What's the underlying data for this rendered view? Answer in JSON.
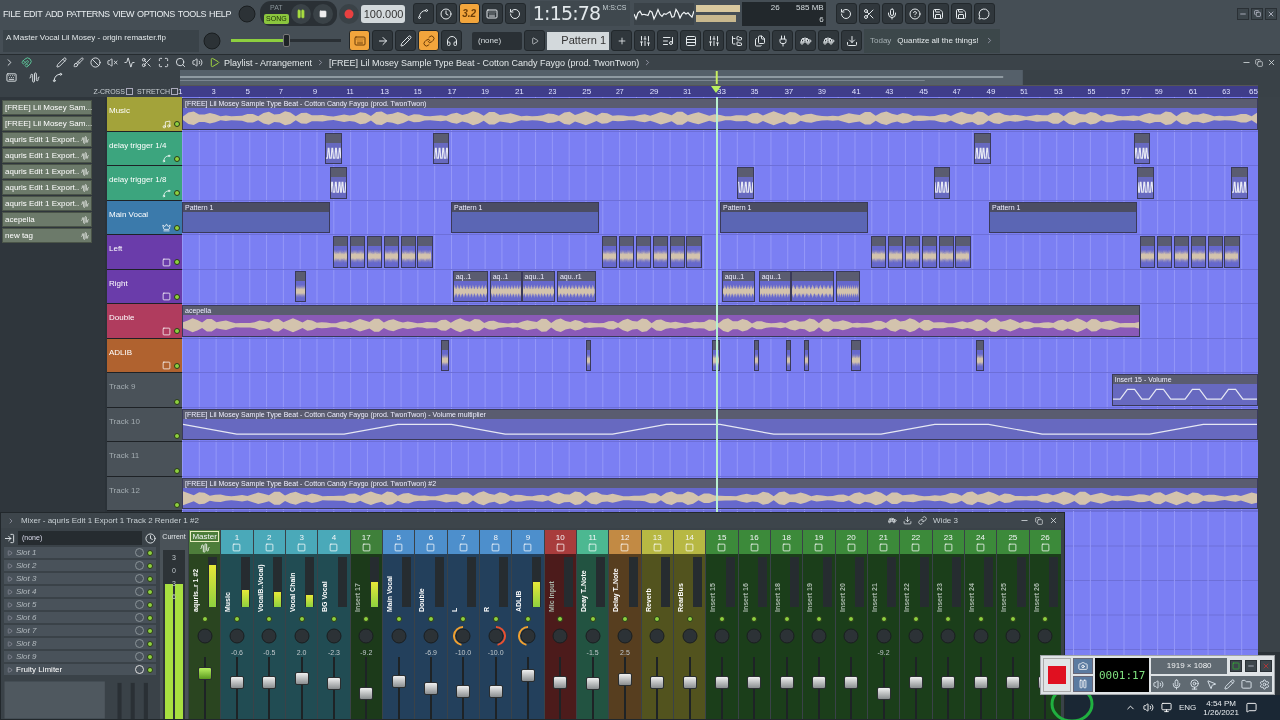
{
  "menu": [
    "FILE",
    "EDIT",
    "ADD",
    "PATTERNS",
    "VIEW",
    "OPTIONS",
    "TOOLS",
    "HELP"
  ],
  "transport": {
    "modes": [
      {
        "label": "PAT",
        "selected": false
      },
      {
        "label": "SONG",
        "selected": true
      }
    ],
    "tempo": "100.000"
  },
  "tools_top": [
    {
      "on": false
    },
    {
      "on": false
    },
    {
      "on": true,
      "label": "3.2"
    },
    {
      "on": false
    },
    {
      "on": false
    }
  ],
  "time": "1:15:78",
  "time_unit": "M:S:CS",
  "monitor": {
    "cpu": "26",
    "memory": "585 MB",
    "polyphony": "6"
  },
  "file_name": "A Master Vocal Lil Mosey - origin remaster.flp",
  "master_volume": {
    "level": 0.5
  },
  "tools_bottom": [
    {
      "on": true
    },
    {
      "on": false
    },
    {
      "on": false
    },
    {
      "on": true
    },
    {
      "on": false
    }
  ],
  "pattern_route": "(none)",
  "pattern": "Pattern 1",
  "hint": {
    "label": "Today",
    "text": "Quantize all the things!"
  },
  "playlist": {
    "title": "Playlist - Arrangement",
    "breadcrumb": "[FREE] Lil Mosey Sample Type Beat  - Cotton Candy Faygo (prod. TwonTwon)",
    "z_cross": {
      "label": "Z-CROSS",
      "checked": false
    },
    "stretch": {
      "label": "STRETCH",
      "checked": false
    },
    "ruler": [
      "1",
      "3",
      "5",
      "7",
      "9",
      "11",
      "13",
      "15",
      "17",
      "19",
      "21",
      "23",
      "25",
      "27",
      "29",
      "31",
      "33",
      "35",
      "37",
      "39",
      "41",
      "43",
      "45",
      "47",
      "49",
      "51",
      "53",
      "55",
      "57",
      "59",
      "61",
      "63",
      "65"
    ],
    "song_position": {
      "level": 0.497
    },
    "tags": [
      "[FREE] Lil Mosey Sam...",
      "[FREE] Lil Mosey Sam...",
      "aquris Edit 1 Export..",
      "aquris Edit 1 Export..",
      "aquris Edit 1 Export..",
      "aquris Edit 1 Export..",
      "aquris Edit 1 Export..",
      "acepella",
      "new tag"
    ],
    "tracks": [
      {
        "name": "Music",
        "color": "#a3a33a",
        "dimmed": false,
        "clips": [
          {
            "kind": "audio",
            "label": "[FREE] Lil Mosey Sample Type Beat  - Cotton Candy Faygo (prod. TwonTwon)"
          }
        ]
      },
      {
        "name": "delay trigger 1/4",
        "color": "#3ca57e",
        "dimmed": false,
        "clips": [
          {
            "kind": "automation"
          },
          {
            "kind": "automation"
          },
          {
            "kind": "automation"
          },
          {
            "kind": "automation"
          }
        ]
      },
      {
        "name": "delay trigger 1/8",
        "color": "#3ca57e",
        "dimmed": false,
        "clips": [
          {
            "kind": "automation"
          },
          {
            "kind": "automation"
          },
          {
            "kind": "automation"
          },
          {
            "kind": "automation"
          },
          {
            "kind": "automation"
          }
        ]
      },
      {
        "name": "Main Vocal",
        "color": "#3b7aab",
        "dimmed": false,
        "clips": [
          {
            "kind": "pattern",
            "label": "Pattern 1"
          },
          {
            "kind": "pattern",
            "label": "Pattern 1"
          },
          {
            "kind": "pattern",
            "label": "Pattern 1"
          },
          {
            "kind": "pattern",
            "label": "Pattern 1"
          }
        ]
      },
      {
        "name": "Left",
        "color": "#6a3caa",
        "dimmed": false,
        "clips": [
          {
            "kind": "audio"
          },
          {
            "kind": "audio"
          },
          {
            "kind": "audio"
          },
          {
            "kind": "audio"
          },
          {
            "kind": "audio"
          },
          {
            "kind": "audio"
          },
          {
            "kind": "audio"
          },
          {
            "kind": "audio"
          },
          {
            "kind": "audio"
          },
          {
            "kind": "audio"
          },
          {
            "kind": "audio"
          },
          {
            "kind": "audio"
          },
          {
            "kind": "audio"
          },
          {
            "kind": "audio"
          },
          {
            "kind": "audio"
          },
          {
            "kind": "audio"
          },
          {
            "kind": "audio"
          },
          {
            "kind": "audio"
          },
          {
            "kind": "audio"
          },
          {
            "kind": "audio"
          },
          {
            "kind": "audio"
          },
          {
            "kind": "audio"
          },
          {
            "kind": "audio"
          },
          {
            "kind": "audio"
          }
        ]
      },
      {
        "name": "Right",
        "color": "#6a3caa",
        "dimmed": false,
        "clips": [
          {
            "kind": "audio"
          },
          {
            "kind": "audio",
            "label": "aq..1"
          },
          {
            "kind": "audio",
            "label": "aq..1"
          },
          {
            "kind": "audio",
            "label": "aqu..1"
          },
          {
            "kind": "audio",
            "label": "aqu..r1"
          },
          {
            "kind": "audio",
            "label": "aqu..1"
          },
          {
            "kind": "audio",
            "label": "aqu..1"
          },
          {
            "kind": "audio"
          },
          {
            "kind": "audio"
          }
        ]
      },
      {
        "name": "Double",
        "color": "#b03c5e",
        "dimmed": false,
        "clips": [
          {
            "kind": "audio",
            "label": "acepella",
            "color": "#8a5ab8"
          }
        ]
      },
      {
        "name": "ADLIB",
        "color": "#b0622f",
        "dimmed": false,
        "clips": [
          {
            "kind": "audio"
          },
          {
            "kind": "audio"
          },
          {
            "kind": "audio"
          },
          {
            "kind": "audio"
          },
          {
            "kind": "audio"
          },
          {
            "kind": "audio"
          },
          {
            "kind": "audio"
          },
          {
            "kind": "audio"
          }
        ]
      },
      {
        "name": "Track 9",
        "color": "#4a5259",
        "dimmed": true,
        "clips": [
          {
            "kind": "automation",
            "label": "Insert 15 - Volume"
          }
        ]
      },
      {
        "name": "Track 10",
        "color": "#4a5259",
        "dimmed": true,
        "clips": [
          {
            "kind": "automation",
            "label": "[FREE] Lil Mosey Sample Type Beat  - Cotton Candy Faygo (prod. TwonTwon) - Volume multiplier"
          }
        ]
      },
      {
        "name": "Track 11",
        "color": "#4a5259",
        "dimmed": true
      },
      {
        "name": "Track 12",
        "color": "#4a5259",
        "dimmed": true,
        "clips": [
          {
            "kind": "audio",
            "label": "[FREE] Lil Mosey Sample Type Beat  - Cotton Candy Faygo (prod. TwonTwon) #2"
          }
        ]
      }
    ]
  },
  "mixer": {
    "title": "Mixer - aquris Edit 1 Export 1 Track 2 Render 1 #2",
    "preset": "Wide 3",
    "route": "(none)",
    "slots": [
      {
        "name": "Slot 1",
        "filled": false
      },
      {
        "name": "Slot 2",
        "filled": false
      },
      {
        "name": "Slot 3",
        "filled": false
      },
      {
        "name": "Slot 4",
        "filled": false
      },
      {
        "name": "Slot 5",
        "filled": false
      },
      {
        "name": "Slot 6",
        "filled": false
      },
      {
        "name": "Slot 7",
        "filled": false
      },
      {
        "name": "Slot 8",
        "filled": false
      },
      {
        "name": "Slot 9",
        "filled": false
      },
      {
        "name": "Fruity Limiter",
        "filled": true
      }
    ],
    "current": {
      "label": "Current",
      "scale": [
        "3",
        "0",
        "3",
        "6"
      ],
      "meter": {
        "level": 0.8
      }
    },
    "strips": [
      {
        "kind": "master",
        "number": "Master",
        "name": "aquris..r 1 #2",
        "color": "#4d7d3a",
        "dimmed": false,
        "fader": {
          "level": 0.8
        },
        "meter": {
          "level": 0.85
        }
      },
      {
        "kind": "insert",
        "number": "1",
        "name": "Music",
        "color": "#4aa9b9",
        "dimmed": false,
        "value": "-0.6",
        "fader": {
          "level": 0.62
        },
        "meter": {
          "level": 0.35
        }
      },
      {
        "kind": "insert",
        "number": "2",
        "name": "VocalB..Vocal)",
        "color": "#4aa9b9",
        "dimmed": false,
        "value": "-0.5",
        "fader": {
          "level": 0.62
        },
        "meter": {
          "level": 0.3
        }
      },
      {
        "kind": "insert",
        "number": "3",
        "name": "Vocal Chain",
        "color": "#4aa9b9",
        "dimmed": false,
        "value": "2.0",
        "fader": {
          "level": 0.7
        },
        "meter": {
          "level": 0.25
        }
      },
      {
        "kind": "insert",
        "number": "4",
        "name": "BG Vocal",
        "color": "#4aa9b9",
        "dimmed": false,
        "value": "-2.3",
        "fader": {
          "level": 0.6
        }
      },
      {
        "kind": "insert",
        "number": "17",
        "name": "Insert 17",
        "color": "#3f803a",
        "dimmed": true,
        "value": "-9.2",
        "fader": {
          "level": 0.38
        },
        "meter": {
          "level": 0.5
        }
      },
      {
        "kind": "insert",
        "number": "5",
        "name": "Main Vocal",
        "color": "#4d8fcc",
        "dimmed": false,
        "fader": {
          "level": 0.64
        }
      },
      {
        "kind": "insert",
        "number": "6",
        "name": "Double",
        "color": "#4d8fcc",
        "dimmed": false,
        "value": "-6.9",
        "fader": {
          "level": 0.5
        }
      },
      {
        "kind": "insert",
        "number": "7",
        "name": "L",
        "color": "#4d8fcc",
        "dimmed": false,
        "value": "-10.0",
        "pan_left": true,
        "fader": {
          "level": 0.42
        }
      },
      {
        "kind": "insert",
        "number": "8",
        "name": "R",
        "color": "#4d8fcc",
        "dimmed": false,
        "value": "-10.0",
        "pan_right": true,
        "fader": {
          "level": 0.42
        }
      },
      {
        "kind": "insert",
        "number": "9",
        "name": "ADLIB",
        "color": "#4d8fcc",
        "dimmed": false,
        "pan_left": true,
        "fader": {
          "level": 0.75
        },
        "meter": {
          "level": 0.5
        }
      },
      {
        "kind": "insert",
        "number": "10",
        "name": "Mic Input",
        "color": "#a83c3c",
        "dimmed": true,
        "fader": {
          "level": 0.62
        }
      },
      {
        "kind": "insert",
        "number": "11",
        "name": "Deay T..Note",
        "color": "#4cb891",
        "dimmed": false,
        "value": "-1.5",
        "fader": {
          "level": 0.6
        }
      },
      {
        "kind": "insert",
        "number": "12",
        "name": "Delay T..Note",
        "color": "#c28a44",
        "dimmed": false,
        "value": "2.5",
        "fader": {
          "level": 0.68
        }
      },
      {
        "kind": "insert",
        "number": "13",
        "name": "Reverb",
        "color": "#b7b843",
        "dimmed": false,
        "fader": {
          "level": 0.62
        }
      },
      {
        "kind": "insert",
        "number": "14",
        "name": "RearBus",
        "color": "#b7b843",
        "dimmed": false,
        "fader": {
          "level": 0.62
        }
      },
      {
        "kind": "insert",
        "number": "15",
        "name": "Insert 15",
        "color": "#3c8a3a",
        "dimmed": true,
        "fader": {
          "level": 0.62
        }
      },
      {
        "kind": "insert",
        "number": "16",
        "name": "Insert 16",
        "color": "#3c8a3a",
        "dimmed": true,
        "fader": {
          "level": 0.62
        }
      },
      {
        "kind": "insert",
        "number": "18",
        "name": "Insert 18",
        "color": "#3c8a3a",
        "dimmed": true,
        "fader": {
          "level": 0.62
        }
      },
      {
        "kind": "insert",
        "number": "19",
        "name": "Insert 19",
        "color": "#3c8a3a",
        "dimmed": true,
        "fader": {
          "level": 0.62
        }
      },
      {
        "kind": "insert",
        "number": "20",
        "name": "Insert 20",
        "color": "#3c8a3a",
        "dimmed": true,
        "fader": {
          "level": 0.62
        }
      },
      {
        "kind": "insert",
        "number": "21",
        "name": "Insert 21",
        "color": "#3c8a3a",
        "dimmed": true,
        "value": "-9.2",
        "fader": {
          "level": 0.38
        }
      },
      {
        "kind": "insert",
        "number": "22",
        "name": "Insert 22",
        "color": "#3c8a3a",
        "dimmed": true,
        "fader": {
          "level": 0.62
        }
      },
      {
        "kind": "insert",
        "number": "23",
        "name": "Insert 23",
        "color": "#3c8a3a",
        "dimmed": true,
        "fader": {
          "level": 0.62
        }
      },
      {
        "kind": "insert",
        "number": "24",
        "name": "Insert 24",
        "color": "#3c8a3a",
        "dimmed": true,
        "fader": {
          "level": 0.62
        }
      },
      {
        "kind": "insert",
        "number": "25",
        "name": "Insert 25",
        "color": "#3c8a3a",
        "dimmed": true,
        "fader": {
          "level": 0.62
        }
      },
      {
        "kind": "insert",
        "number": "26",
        "name": "Insert 26",
        "color": "#3c8a3a",
        "dimmed": true,
        "fader": {
          "level": 0.62
        }
      }
    ]
  },
  "recorder": {
    "timer": "0001:17",
    "resolution": "1919 × 1080"
  },
  "taskbar": {
    "language": "ENG",
    "time": "4:54 PM",
    "date": "1/26/2021"
  }
}
